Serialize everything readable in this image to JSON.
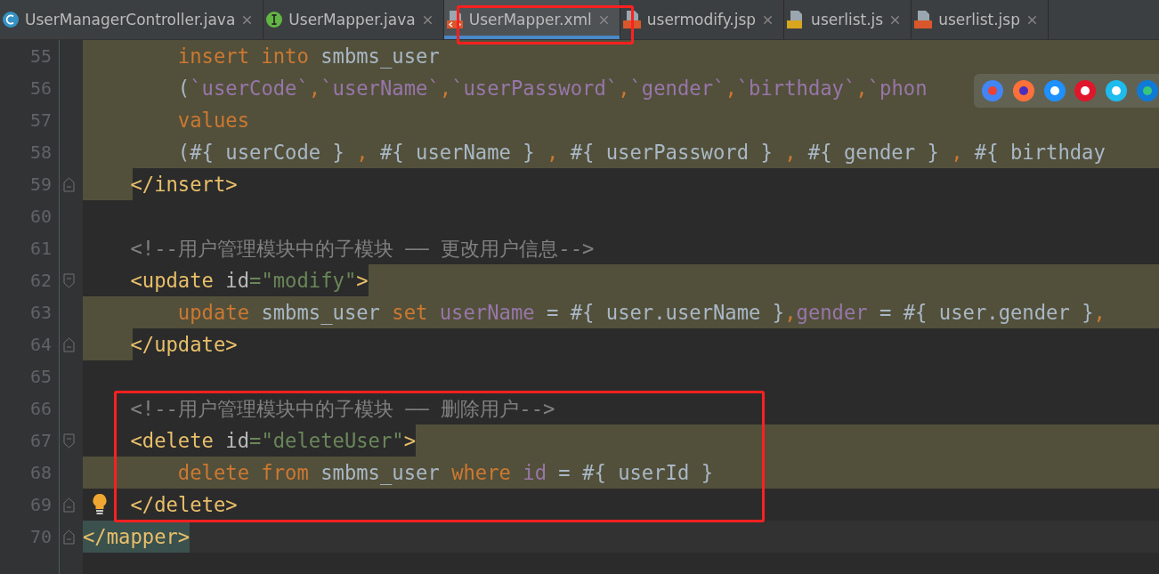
{
  "tabs": [
    {
      "label": "UserManagerController.java",
      "kind": "class",
      "selected": false
    },
    {
      "label": "UserMapper.java",
      "kind": "interface",
      "selected": false
    },
    {
      "label": "UserMapper.xml",
      "kind": "xml",
      "selected": true
    },
    {
      "label": "usermodify.jsp",
      "kind": "jsp",
      "selected": false
    },
    {
      "label": "userlist.js",
      "kind": "js",
      "selected": false
    },
    {
      "label": "userlist.jsp",
      "kind": "jsp",
      "selected": false
    }
  ],
  "lines": [
    {
      "number": "55",
      "kind": "full",
      "tokens": [
        {
          "kind": "kw",
          "text": "        insert into "
        },
        {
          "kind": "plain",
          "text": "smbms_user"
        }
      ]
    },
    {
      "number": "56",
      "kind": "full",
      "tokens": [
        {
          "kind": "plain",
          "text": "        ("
        },
        {
          "kind": "field",
          "text": "`userCode`"
        },
        {
          "kind": "kw",
          "text": ","
        },
        {
          "kind": "field",
          "text": "`userName`"
        },
        {
          "kind": "kw",
          "text": ","
        },
        {
          "kind": "field",
          "text": "`userPassword`"
        },
        {
          "kind": "kw",
          "text": ","
        },
        {
          "kind": "field",
          "text": "`gender`"
        },
        {
          "kind": "kw",
          "text": ","
        },
        {
          "kind": "field",
          "text": "`birthday`"
        },
        {
          "kind": "kw",
          "text": ","
        },
        {
          "kind": "field",
          "text": "`phon"
        }
      ]
    },
    {
      "number": "57",
      "kind": "full",
      "tokens": [
        {
          "kind": "kw",
          "text": "        values"
        }
      ]
    },
    {
      "number": "58",
      "kind": "full",
      "tokens": [
        {
          "kind": "plain",
          "text": "        (#{ userCode } "
        },
        {
          "kind": "kw",
          "text": ","
        },
        {
          "kind": "plain",
          "text": " #{ userName } "
        },
        {
          "kind": "kw",
          "text": ","
        },
        {
          "kind": "plain",
          "text": " #{ userPassword } "
        },
        {
          "kind": "kw",
          "text": ","
        },
        {
          "kind": "plain",
          "text": " #{ gender } "
        },
        {
          "kind": "kw",
          "text": ","
        },
        {
          "kind": "plain",
          "text": " #{ birthday"
        }
      ]
    },
    {
      "number": "59",
      "kind": "indent",
      "fold": {
        "kind": "end"
      },
      "tokens": [
        {
          "kind": "tag",
          "text": "    </insert>"
        }
      ]
    },
    {
      "number": "60",
      "kind": "plain"
    },
    {
      "number": "61",
      "kind": "plain",
      "tokens": [
        {
          "kind": "cm",
          "text": "    <!--用户管理模块中的子模块 —— 更改用户信息-->"
        }
      ]
    },
    {
      "number": "62",
      "kind": "after",
      "fold": {
        "kind": "start"
      },
      "tokens": [
        {
          "kind": "tag",
          "text": "    <update"
        },
        {
          "kind": "attr",
          "text": " id"
        },
        {
          "kind": "str",
          "text": "=\"modify\""
        },
        {
          "kind": "tag",
          "text": ">"
        }
      ]
    },
    {
      "number": "63",
      "kind": "full",
      "tokens": [
        {
          "kind": "kw",
          "text": "        update "
        },
        {
          "kind": "plain",
          "text": "smbms_user "
        },
        {
          "kind": "kw",
          "text": "set "
        },
        {
          "kind": "field",
          "text": "userName"
        },
        {
          "kind": "plain",
          "text": " = #{ user.userName }"
        },
        {
          "kind": "kw",
          "text": ","
        },
        {
          "kind": "field",
          "text": "gender"
        },
        {
          "kind": "plain",
          "text": " = #{ user.gender }"
        },
        {
          "kind": "kw",
          "text": ","
        }
      ]
    },
    {
      "number": "64",
      "kind": "indent",
      "fold": {
        "kind": "end"
      },
      "tokens": [
        {
          "kind": "tag",
          "text": "    </update>"
        }
      ]
    },
    {
      "number": "65",
      "kind": "plain"
    },
    {
      "number": "66",
      "kind": "plain",
      "tokens": [
        {
          "kind": "cm",
          "text": "    <!--用户管理模块中的子模块 —— 删除用户-->"
        }
      ]
    },
    {
      "number": "67",
      "kind": "after",
      "fold": {
        "kind": "start"
      },
      "tokens": [
        {
          "kind": "tag",
          "text": "    <delete"
        },
        {
          "kind": "attr",
          "text": " id"
        },
        {
          "kind": "str",
          "text": "=\"deleteUser\""
        },
        {
          "kind": "tag",
          "text": ">"
        }
      ]
    },
    {
      "number": "68",
      "kind": "full",
      "tokens": [
        {
          "kind": "kw",
          "text": "        delete from "
        },
        {
          "kind": "plain",
          "text": "smbms_user "
        },
        {
          "kind": "kw",
          "text": "where "
        },
        {
          "kind": "field",
          "text": "id"
        },
        {
          "kind": "plain",
          "text": " = #{ userId }"
        }
      ]
    },
    {
      "number": "69",
      "kind": "plain",
      "fold": {
        "kind": "end"
      },
      "bulb": true,
      "tokens": [
        {
          "kind": "tag",
          "text": "</delete>"
        }
      ]
    },
    {
      "number": "70",
      "kind": "current",
      "fold": {
        "kind": "end"
      },
      "tokens": [
        {
          "kind": "tag",
          "text": "</mapper>"
        }
      ]
    }
  ]
}
